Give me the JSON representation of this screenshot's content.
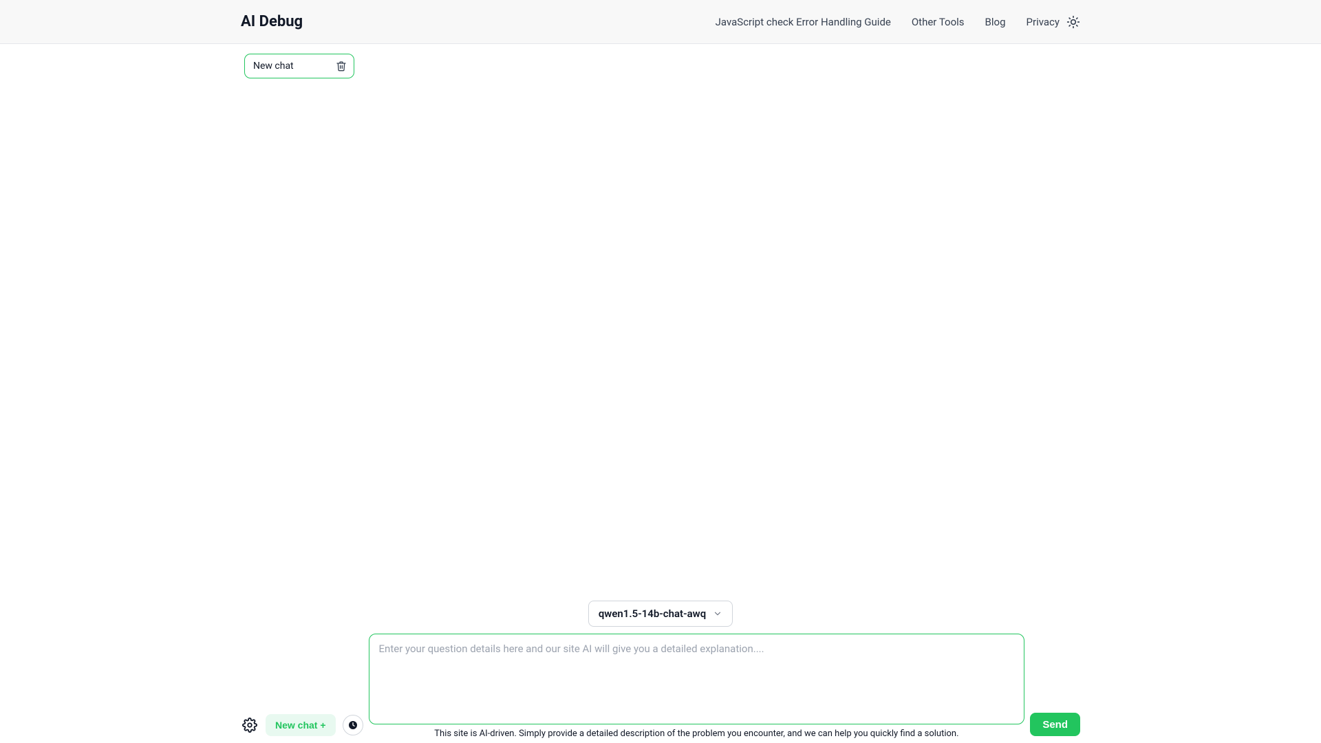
{
  "header": {
    "brand": "AI Debug",
    "nav": {
      "guide": "JavaScript check Error Handling Guide",
      "other_tools": "Other Tools",
      "blog": "Blog",
      "privacy": "Privacy"
    }
  },
  "sidebar": {
    "active_chat_label": "New chat"
  },
  "composer": {
    "model_selected": "qwen1.5-14b-chat-awq",
    "newchat_label": "New chat +",
    "send_label": "Send",
    "textarea_value": "",
    "textarea_placeholder": "Enter your question details here and our site AI will give you a detailed explanation....",
    "hint": "This site is AI-driven. Simply provide a detailed description of the problem you encounter, and we can help you quickly find a solution."
  },
  "icons": {
    "theme": "sun-icon",
    "trash": "trash-icon",
    "chevron": "chevron-down-icon",
    "settings": "gear-icon",
    "history": "clock-icon"
  },
  "colors": {
    "accent": "#22c55e",
    "header_bg": "#f8f8f8",
    "border": "#e5e7eb"
  }
}
